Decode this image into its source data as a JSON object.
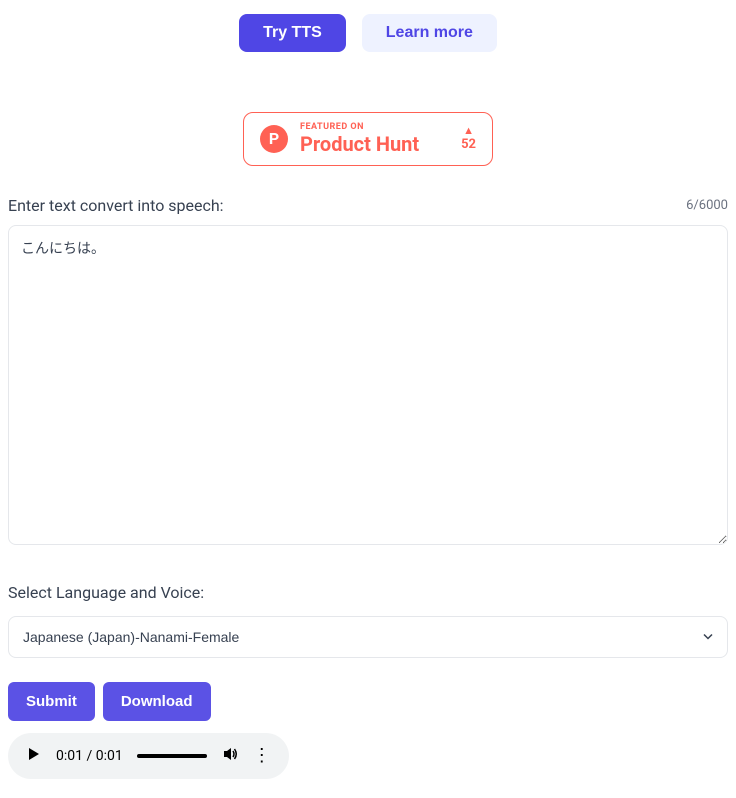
{
  "top_buttons": {
    "try_tts": "Try TTS",
    "learn_more": "Learn more"
  },
  "product_hunt": {
    "logo_letter": "P",
    "featured_label": "FEATURED ON",
    "name": "Product Hunt",
    "votes": "52"
  },
  "text_input": {
    "label": "Enter text convert into speech:",
    "char_count": "6/6000",
    "value": "こんにちは。"
  },
  "voice": {
    "label": "Select Language and Voice:",
    "selected": "Japanese (Japan)-Nanami-Female"
  },
  "actions": {
    "submit": "Submit",
    "download": "Download"
  },
  "audio": {
    "current_time": "0:01",
    "duration": "0:01"
  }
}
